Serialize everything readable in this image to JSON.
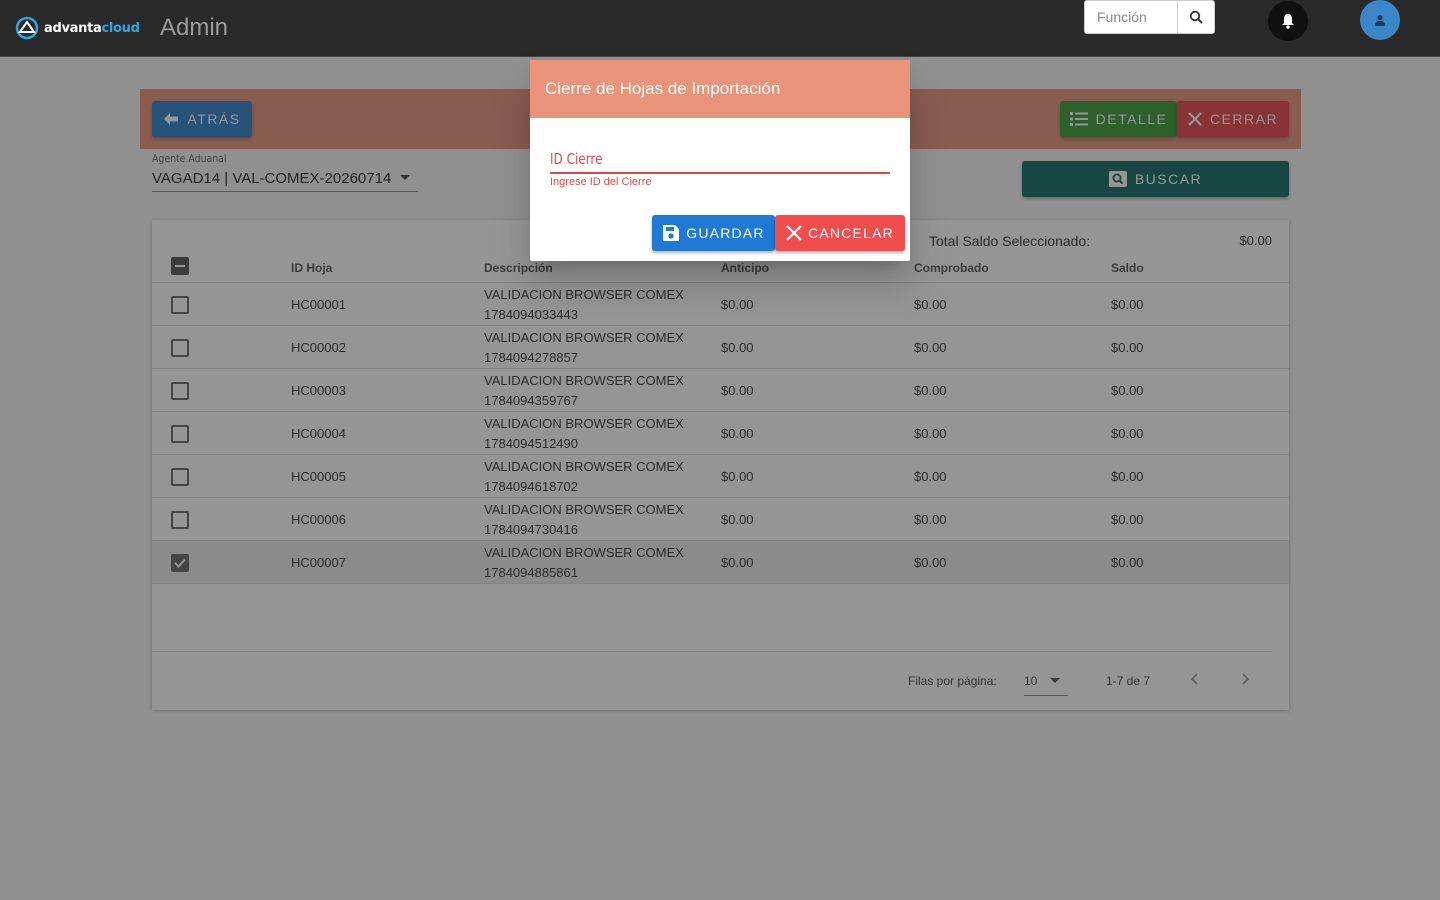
{
  "topbar": {
    "logo_text_a": "advanta",
    "logo_text_b": "cloud",
    "title": "Admin",
    "search_placeholder": "Función",
    "icons": [
      "search-icon",
      "bell-icon",
      "user-icon"
    ]
  },
  "toolbar": {
    "back_label": "ATRÁS",
    "detalle_label": "DETALLE",
    "cerrar_label": "CERRAR",
    "buscar_label": "BUSCAR"
  },
  "agente": {
    "label": "Agente Aduanal",
    "value": "VAGAD14 | VAL-COMEX-20260714"
  },
  "table": {
    "total_label": "Total Saldo Seleccionado:",
    "total_value": "$0.00",
    "headers": [
      "ID Hoja",
      "Descripción",
      "Anticipo",
      "Comprobado",
      "Saldo"
    ],
    "rows": [
      {
        "id": "HC00001",
        "desc1": "VALIDACION BROWSER COMEX",
        "desc2": "1784094033443",
        "anticipo": "$0.00",
        "comprobado": "$0.00",
        "saldo": "$0.00",
        "checked": false
      },
      {
        "id": "HC00002",
        "desc1": "VALIDACION BROWSER COMEX",
        "desc2": "1784094278857",
        "anticipo": "$0.00",
        "comprobado": "$0.00",
        "saldo": "$0.00",
        "checked": false
      },
      {
        "id": "HC00003",
        "desc1": "VALIDACION BROWSER COMEX",
        "desc2": "1784094359767",
        "anticipo": "$0.00",
        "comprobado": "$0.00",
        "saldo": "$0.00",
        "checked": false
      },
      {
        "id": "HC00004",
        "desc1": "VALIDACION BROWSER COMEX",
        "desc2": "1784094512490",
        "anticipo": "$0.00",
        "comprobado": "$0.00",
        "saldo": "$0.00",
        "checked": false
      },
      {
        "id": "HC00005",
        "desc1": "VALIDACION BROWSER COMEX",
        "desc2": "1784094618702",
        "anticipo": "$0.00",
        "comprobado": "$0.00",
        "saldo": "$0.00",
        "checked": false
      },
      {
        "id": "HC00006",
        "desc1": "VALIDACION BROWSER COMEX",
        "desc2": "1784094730416",
        "anticipo": "$0.00",
        "comprobado": "$0.00",
        "saldo": "$0.00",
        "checked": false
      },
      {
        "id": "HC00007",
        "desc1": "VALIDACION BROWSER COMEX",
        "desc2": "1784094885861",
        "anticipo": "$0.00",
        "comprobado": "$0.00",
        "saldo": "$0.00",
        "checked": true
      }
    ]
  },
  "pager": {
    "rows_label": "Filas por página:",
    "rows_value": "10",
    "range": "1-7 de 7"
  },
  "modal": {
    "title": "Cierre de Hojas de Importación",
    "field_label": "ID Cierre",
    "field_error": "Ingrese ID del Cierre",
    "guardar_label": "GUARDAR",
    "cancelar_label": "CANCELAR"
  },
  "colors": {
    "header_accent": "#e8937a",
    "primary": "#1f7ad6",
    "danger": "#f04d4d",
    "success": "#3a9a3a",
    "teal": "#0d6b5e"
  }
}
